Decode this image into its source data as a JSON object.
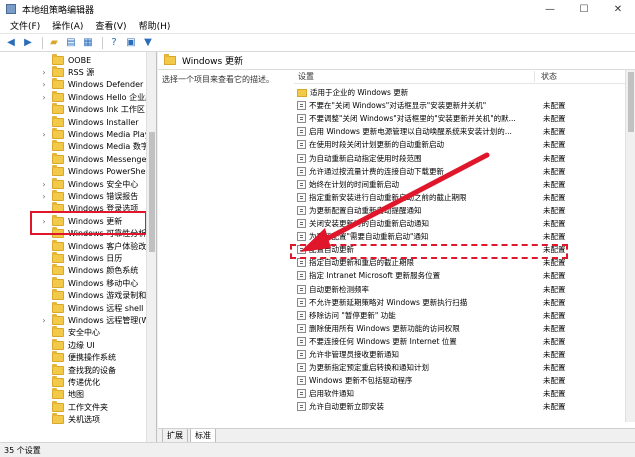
{
  "window": {
    "title": "本地组策略编辑器",
    "min": "—",
    "max": "☐",
    "close": "✕"
  },
  "menu": [
    "文件(F)",
    "操作(A)",
    "查看(V)",
    "帮助(H)"
  ],
  "toolbar_icons": [
    "back-icon",
    "forward-icon",
    "folder-up-icon",
    "show-hide-tree-icon",
    "export-list-icon",
    "help-icon",
    "properties-icon",
    "filter-icon"
  ],
  "tree": {
    "items": [
      {
        "label": "OOBE",
        "chev": ""
      },
      {
        "label": "RSS 源",
        "chev": "›"
      },
      {
        "label": "Windows Defender Sm",
        "chev": "›"
      },
      {
        "label": "Windows Hello 企业版",
        "chev": "›"
      },
      {
        "label": "Windows Ink 工作区",
        "chev": ""
      },
      {
        "label": "Windows Installer",
        "chev": ""
      },
      {
        "label": "Windows Media Playe",
        "chev": "›"
      },
      {
        "label": "Windows Media 数字",
        "chev": ""
      },
      {
        "label": "Windows Messenger",
        "chev": ""
      },
      {
        "label": "Windows PowerShell",
        "chev": ""
      },
      {
        "label": "Windows 安全中心",
        "chev": "›"
      },
      {
        "label": "Windows 错误报告",
        "chev": "›"
      },
      {
        "label": "Windows 登录选项",
        "chev": ""
      },
      {
        "label": "Windows 更新",
        "chev": "›"
      },
      {
        "label": "Windows 可靠性分析",
        "chev": ""
      },
      {
        "label": "Windows 客户体验改善",
        "chev": ""
      },
      {
        "label": "Windows 日历",
        "chev": ""
      },
      {
        "label": "Windows 颜色系统",
        "chev": ""
      },
      {
        "label": "Windows 移动中心",
        "chev": ""
      },
      {
        "label": "Windows 游戏录制和广",
        "chev": ""
      },
      {
        "label": "Windows 远程 shell",
        "chev": ""
      },
      {
        "label": "Windows 远程管理(Wi",
        "chev": "›"
      },
      {
        "label": "安全中心",
        "chev": ""
      },
      {
        "label": "边缘 UI",
        "chev": ""
      },
      {
        "label": "便携操作系统",
        "chev": ""
      },
      {
        "label": "查找我的设备",
        "chev": ""
      },
      {
        "label": "传递优化",
        "chev": ""
      },
      {
        "label": "地图",
        "chev": ""
      },
      {
        "label": "工作文件夹",
        "chev": ""
      },
      {
        "label": "关机选项",
        "chev": ""
      }
    ]
  },
  "right": {
    "header": "Windows 更新",
    "description": "选择一个项目来查看它的描述。",
    "col_setting": "设置",
    "col_state": "状态",
    "rows": [
      {
        "name": "适用于企业的 Windows 更新",
        "state": "",
        "folder": true
      },
      {
        "name": "不要在\"关闭 Windows\"对话框显示\"安装更新并关机\"",
        "state": "未配置"
      },
      {
        "name": "不要调整\"关闭 Windows\"对话框里的\"安装更新并关机\"的默...",
        "state": "未配置"
      },
      {
        "name": "启用 Windows 更新电源管理以自动唤醒系统来安装计划的...",
        "state": "未配置"
      },
      {
        "name": "在使用时段关闭计划更新的自动重新启动",
        "state": "未配置"
      },
      {
        "name": "为自动重新启动指定使用时段范围",
        "state": "未配置"
      },
      {
        "name": "允许通过按流量计费的连接自动下载更新",
        "state": "未配置"
      },
      {
        "name": "始终在计划的时间重新启动",
        "state": "未配置"
      },
      {
        "name": "指定重新安装进行自动重新启动之前的截止期限",
        "state": "未配置"
      },
      {
        "name": "为更新配置自动重新启动提醒通知",
        "state": "未配置"
      },
      {
        "name": "关闭安装更新时的自动重新启动通知",
        "state": "未配置"
      },
      {
        "name": "为更新配置\"需要自动重新启动\"通知",
        "state": "未配置"
      },
      {
        "name": "配置自动更新",
        "state": "未配置"
      },
      {
        "name": "指定自动更新和重启的截止期限",
        "state": "未配置"
      },
      {
        "name": "指定 Intranet Microsoft 更新服务位置",
        "state": "未配置"
      },
      {
        "name": "自动更新检测频率",
        "state": "未配置"
      },
      {
        "name": "不允许更新延期策略对 Windows 更新执行扫描",
        "state": "未配置"
      },
      {
        "name": "移除访问 \"暂停更新\" 功能",
        "state": "未配置"
      },
      {
        "name": "删除使用所有 Windows 更新功能的访问权限",
        "state": "未配置"
      },
      {
        "name": "不要连接任何 Windows 更新 Internet 位置",
        "state": "未配置"
      },
      {
        "name": "允许非管理员接收更新通知",
        "state": "未配置"
      },
      {
        "name": "为更新指定预定重启转换和通知计划",
        "state": "未配置"
      },
      {
        "name": "Windows 更新不包括驱动程序",
        "state": "未配置"
      },
      {
        "name": "启用软件通知",
        "state": "未配置"
      },
      {
        "name": "允许自动更新立即安装",
        "state": "未配置"
      }
    ]
  },
  "tabs": [
    "扩展",
    "标准"
  ],
  "status": "35 个设置",
  "colors": {
    "highlight": "#e0162b",
    "folder": "#f3c94a"
  }
}
